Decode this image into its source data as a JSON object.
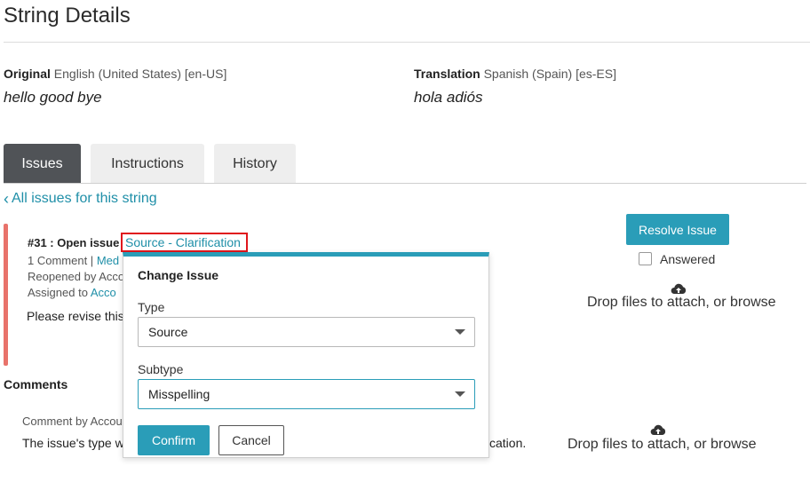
{
  "page_title": "String Details",
  "original": {
    "label": "Original",
    "language": "English (United States) [en-US]",
    "text": "hello good bye"
  },
  "translation": {
    "label": "Translation",
    "language": "Spanish (Spain) [es-ES]",
    "text": "hola adiós"
  },
  "tabs": [
    {
      "label": "Issues",
      "active": true
    },
    {
      "label": "Instructions",
      "active": false
    },
    {
      "label": "History",
      "active": false
    }
  ],
  "back_link": "All issues for this string",
  "issue": {
    "title": "#31 : Open issue",
    "subtype_link": "Source - Clarification",
    "comment_count": "1 Comment |",
    "comment_meta_link": "Med",
    "reopened_by": "Reopened by Acco",
    "assigned_to_label": "Assigned to",
    "assigned_to_link": "Acco",
    "body": "Please revise this"
  },
  "resolve_button": "Resolve Issue",
  "answered_label": "Answered",
  "drop_text": "Drop files to attach, or browse",
  "comments_heading": "Comments",
  "comment": {
    "author_prefix": "Comment by Accou",
    "text_start": "The issue's type w",
    "text_end": "cation."
  },
  "change_issue": {
    "title": "Change Issue",
    "type_label": "Type",
    "type_value": "Source",
    "subtype_label": "Subtype",
    "subtype_value": "Misspelling",
    "confirm_label": "Confirm",
    "cancel_label": "Cancel"
  },
  "colors": {
    "accent": "#2a9db8",
    "link": "#1f8fa8",
    "issue_bar": "#e8736b",
    "highlight": "#e0161c",
    "active_tab": "#505357"
  }
}
